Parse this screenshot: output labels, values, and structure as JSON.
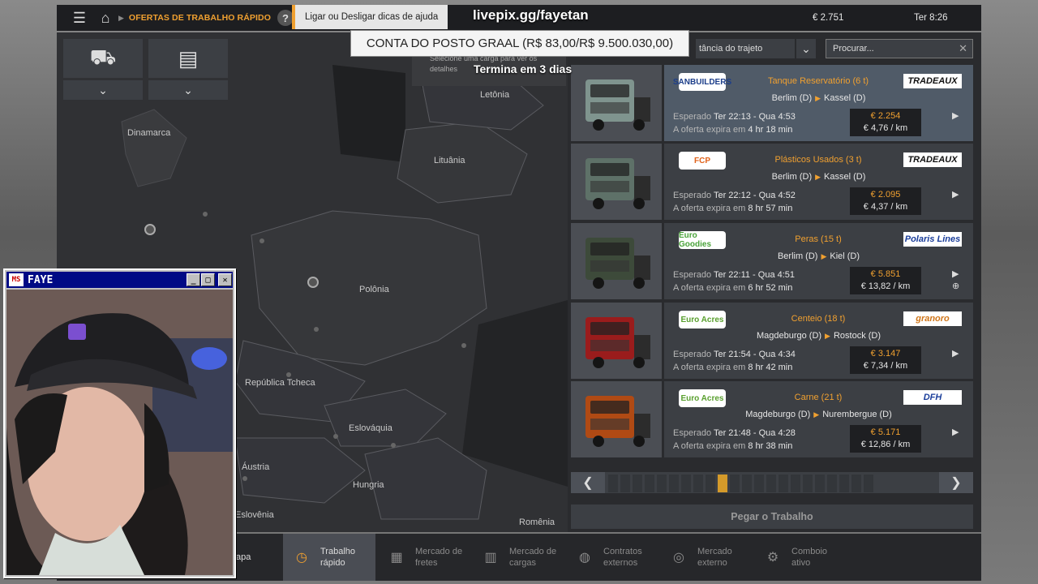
{
  "topbar": {
    "breadcrumb": "OFERTAS DE TRABALHO RÁPIDO",
    "help_label": "?",
    "tooltip": "Ligar ou Desligar dicas de ajuda",
    "money": "€ 2.751",
    "clock": "Ter 8:26"
  },
  "overlay": {
    "url": "livepix.gg/fayetan",
    "banner": "CONTA DO POSTO GRAAL (R$ 83,00/R$ 9.500.030,00)",
    "banner_sub": "Termina em 3 dias"
  },
  "map": {
    "hint": "Selecione uma carga para ver os detalhes",
    "labels": [
      {
        "text": "Letônia"
      },
      {
        "text": "Dinamarca"
      },
      {
        "text": "Lituânia"
      },
      {
        "text": "Polônia"
      },
      {
        "text": "República Tcheca"
      },
      {
        "text": "Eslováquia"
      },
      {
        "text": "Áustria"
      },
      {
        "text": "Hungria"
      },
      {
        "text": "Eslovênia"
      },
      {
        "text": "Romênia"
      }
    ]
  },
  "filters": {
    "sort_label": "tância do trajeto",
    "search_placeholder": "Procurar..."
  },
  "jobs": [
    {
      "logo": "SANBUILDERS",
      "cargo": "Tanque Reservatório (6 t)",
      "company": "TRADEAUX",
      "from": "Berlim (D)",
      "to": "Kassel (D)",
      "expected_label": "Esperado",
      "expected": "Ter 22:13 - Qua 4:53",
      "expire_label": "A oferta expira em",
      "expire": "4 hr 18 min",
      "price": "€ 2.254",
      "per_km": "€ 4,76 / km",
      "cab_color": "#7f948e"
    },
    {
      "logo": "FCP",
      "cargo": "Plásticos Usados (3 t)",
      "company": "TRADEAUX",
      "from": "Berlim (D)",
      "to": "Kassel (D)",
      "expected_label": "Esperado",
      "expected": "Ter 22:12 - Qua 4:52",
      "expire_label": "A oferta expira em",
      "expire": "8 hr 57 min",
      "price": "€ 2.095",
      "per_km": "€ 4,37 / km",
      "cab_color": "#5e7168"
    },
    {
      "logo": "Euro Goodies",
      "cargo": "Peras (15 t)",
      "company": "Polaris Lines",
      "from": "Berlim (D)",
      "to": "Kiel (D)",
      "expected_label": "Esperado",
      "expected": "Ter 22:11 - Qua 4:51",
      "expire_label": "A oferta expira em",
      "expire": "6 hr 52 min",
      "price": "€ 5.851",
      "per_km": "€ 13,82 / km",
      "cab_color": "#3d4a3a"
    },
    {
      "logo": "Euro Acres",
      "cargo": "Centeio (18 t)",
      "company": "granoro",
      "from": "Magdeburgo (D)",
      "to": "Rostock (D)",
      "expected_label": "Esperado",
      "expected": "Ter 21:54 - Qua 4:34",
      "expire_label": "A oferta expira em",
      "expire": "8 hr 42 min",
      "price": "€ 3.147",
      "per_km": "€ 7,34 / km",
      "cab_color": "#9a1c1c"
    },
    {
      "logo": "Euro Acres",
      "cargo": "Carne (21 t)",
      "company": "DFH",
      "from": "Magdeburgo (D)",
      "to": "Nurembergue (D)",
      "expected_label": "Esperado",
      "expected": "Ter 21:48 - Qua 4:28",
      "expire_label": "A oferta expira em",
      "expire": "8 hr 38 min",
      "price": "€ 5.171",
      "per_km": "€ 12,86 / km",
      "cab_color": "#b04a14"
    }
  ],
  "pager": {
    "total": 22,
    "current": 10
  },
  "take_job": "Pegar o Trabalho",
  "nav": {
    "mapa": "apa",
    "items": [
      {
        "label": "Trabalho\nrápido",
        "icon": "clock-icon",
        "glyph": "◷"
      },
      {
        "label": "Mercado de\nfretes",
        "icon": "boxes-icon",
        "glyph": "▦"
      },
      {
        "label": "Mercado de\ncargas",
        "icon": "cargo-icon",
        "glyph": "▥"
      },
      {
        "label": "Contratos\nexternos",
        "icon": "globe-icon",
        "glyph": "◍"
      },
      {
        "label": "Mercado\nexterno",
        "icon": "globe-cargo-icon",
        "glyph": "◎"
      },
      {
        "label": "Comboio\nativo",
        "icon": "convoy-icon",
        "glyph": "⚙"
      }
    ]
  },
  "webcam": {
    "title": "FAYE",
    "app_icon": "MS",
    "minimize": "_",
    "maximize": "□",
    "close": "✕"
  },
  "colors": {
    "accent": "#f0a030",
    "panel": "#2a2b2e",
    "card": "#3c3f44",
    "card_active": "#505b68",
    "cam_title": "#000a85"
  }
}
